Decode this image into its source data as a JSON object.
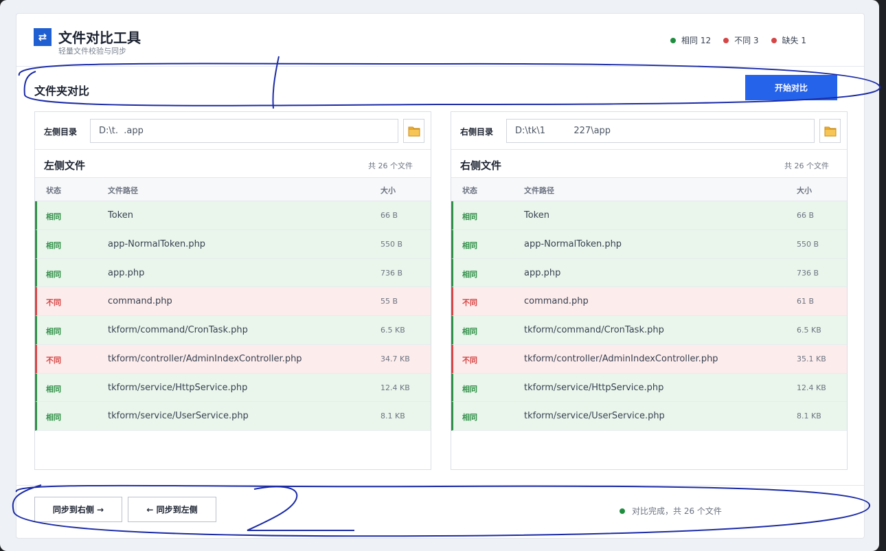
{
  "header": {
    "title": "文件对比工具",
    "subtitle": "轻量文件校验与同步",
    "logo_glyph": "⇄",
    "stats": [
      {
        "label": "相同 12",
        "color": "#1e8e3e"
      },
      {
        "label": "不同 3",
        "color": "#d64545"
      },
      {
        "label": "缺失 1",
        "color": "#d64545"
      }
    ]
  },
  "toolbar": {
    "section_title": "文件夹对比",
    "start_label": "开始对比"
  },
  "left_panel": {
    "dir_label": "左侧目录",
    "dir_value": "D:\\t.  .app",
    "files_title": "左侧文件",
    "files_count": "共 26 个文件",
    "columns": {
      "status": "状态",
      "path": "文件路径",
      "size": "大小"
    },
    "rows": [
      {
        "status": "相同",
        "path": "Token",
        "size": "66 B",
        "kind": "same"
      },
      {
        "status": "相同",
        "path": "app-NormalToken.php",
        "size": "550 B",
        "kind": "same"
      },
      {
        "status": "相同",
        "path": "app.php",
        "size": "736 B",
        "kind": "same"
      },
      {
        "status": "不同",
        "path": "command.php",
        "size": "55 B",
        "kind": "diff"
      },
      {
        "status": "相同",
        "path": "tkform/command/CronTask.php",
        "size": "6.5 KB",
        "kind": "same"
      },
      {
        "status": "不同",
        "path": "tkform/controller/AdminIndexController.php",
        "size": "34.7 KB",
        "kind": "diff"
      },
      {
        "status": "相同",
        "path": "tkform/service/HttpService.php",
        "size": "12.4 KB",
        "kind": "same"
      },
      {
        "status": "相同",
        "path": "tkform/service/UserService.php",
        "size": "8.1 KB",
        "kind": "same"
      }
    ]
  },
  "right_panel": {
    "dir_label": "右侧目录",
    "dir_value": "D:\\tk\\1          227\\app",
    "files_title": "右侧文件",
    "files_count": "共 26 个文件",
    "columns": {
      "status": "状态",
      "path": "文件路径",
      "size": "大小"
    },
    "rows": [
      {
        "status": "相同",
        "path": "Token",
        "size": "66 B",
        "kind": "same"
      },
      {
        "status": "相同",
        "path": "app-NormalToken.php",
        "size": "550 B",
        "kind": "same"
      },
      {
        "status": "相同",
        "path": "app.php",
        "size": "736 B",
        "kind": "same"
      },
      {
        "status": "不同",
        "path": "command.php",
        "size": "61 B",
        "kind": "diff"
      },
      {
        "status": "相同",
        "path": "tkform/command/CronTask.php",
        "size": "6.5 KB",
        "kind": "same"
      },
      {
        "status": "不同",
        "path": "tkform/controller/AdminIndexController.php",
        "size": "35.1 KB",
        "kind": "diff"
      },
      {
        "status": "相同",
        "path": "tkform/service/HttpService.php",
        "size": "12.4 KB",
        "kind": "same"
      },
      {
        "status": "相同",
        "path": "tkform/service/UserService.php",
        "size": "8.1 KB",
        "kind": "same"
      }
    ]
  },
  "footer": {
    "sync_right_label": "同步到右侧 →",
    "sync_left_label": "← 同步到左侧",
    "status_text": "对比完成，共 26 个文件",
    "status_color": "#1e8e3e"
  },
  "icons": {
    "logo": "swap-icon",
    "folder": "folder-icon",
    "status_dot": "dot-icon"
  },
  "colors": {
    "accent": "#2563eb",
    "same": "#2f8f47",
    "diff": "#d64545",
    "ink": "#1a2aa6"
  }
}
